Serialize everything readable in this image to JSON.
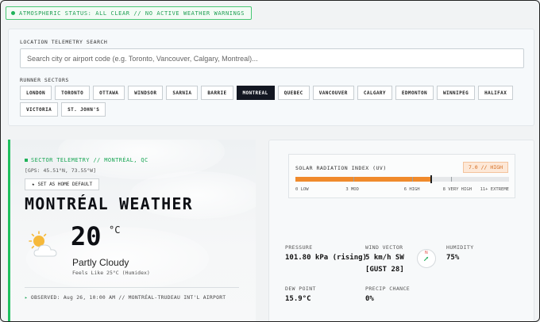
{
  "status": {
    "text": "ATMOSPHERIC STATUS: ALL CLEAR // NO ACTIVE WEATHER WARNINGS",
    "color": "#1e9e52"
  },
  "search": {
    "label": "LOCATION TELEMETRY SEARCH",
    "placeholder": "Search city or airport code (e.g. Toronto, Vancouver, Calgary, Montreal)..."
  },
  "sectors": {
    "label": "RUNNER SECTORS",
    "items": [
      "LONDON",
      "TORONTO",
      "OTTAWA",
      "WINDSOR",
      "SARNIA",
      "BARRIE",
      "MONTREAL",
      "QUEBEC",
      "VANCOUVER",
      "CALGARY",
      "EDMONTON",
      "WINNIPEG",
      "HALIFAX",
      "VICTORIA",
      "ST. JOHN'S"
    ],
    "active": "MONTREAL"
  },
  "weather": {
    "sector_title": "SECTOR TELEMETRY // MONTRÉAL, QC",
    "gps": "[GPS: 45.51°N, 73.55°W]",
    "home_button": "SET AS HOME DEFAULT",
    "city_title": "MONTRÉAL WEATHER",
    "icon": "partly-cloudy-icon",
    "temperature": "20",
    "unit": "°C",
    "condition": "Partly Cloudy",
    "feels_like": "Feels Like 25°C (Humidex)",
    "observed": "OBSERVED: Aug 26, 10:00 AM // MONTRÉAL-TRUDEAU INT'L AIRPORT"
  },
  "uv": {
    "title": "SOLAR RADIATION INDEX (UV)",
    "badge": "7.0 // HIGH",
    "value": 7.0,
    "max": 11,
    "scale": [
      {
        "label": "0 LOW",
        "value": 0
      },
      {
        "label": "3 MOD",
        "value": 3
      },
      {
        "label": "6 HIGH",
        "value": 6
      },
      {
        "label": "8 VERY HIGH",
        "value": 8
      },
      {
        "label": "11+ EXTREME",
        "value": 11
      }
    ],
    "accent": "#f08a2c"
  },
  "metrics": {
    "pressure_label": "PRESSURE",
    "pressure_value": "101.80 kPa (rising)",
    "wind_label": "WIND VECTOR",
    "wind_value": "5 km/h SW",
    "wind_gust": "[GUST 28]",
    "compass_north": "N",
    "humidity_label": "HUMIDITY",
    "humidity_value": "75%",
    "dewpoint_label": "DEW POINT",
    "dewpoint_value": "15.9°C",
    "precip_label": "PRECIP CHANCE",
    "precip_value": "0%"
  }
}
